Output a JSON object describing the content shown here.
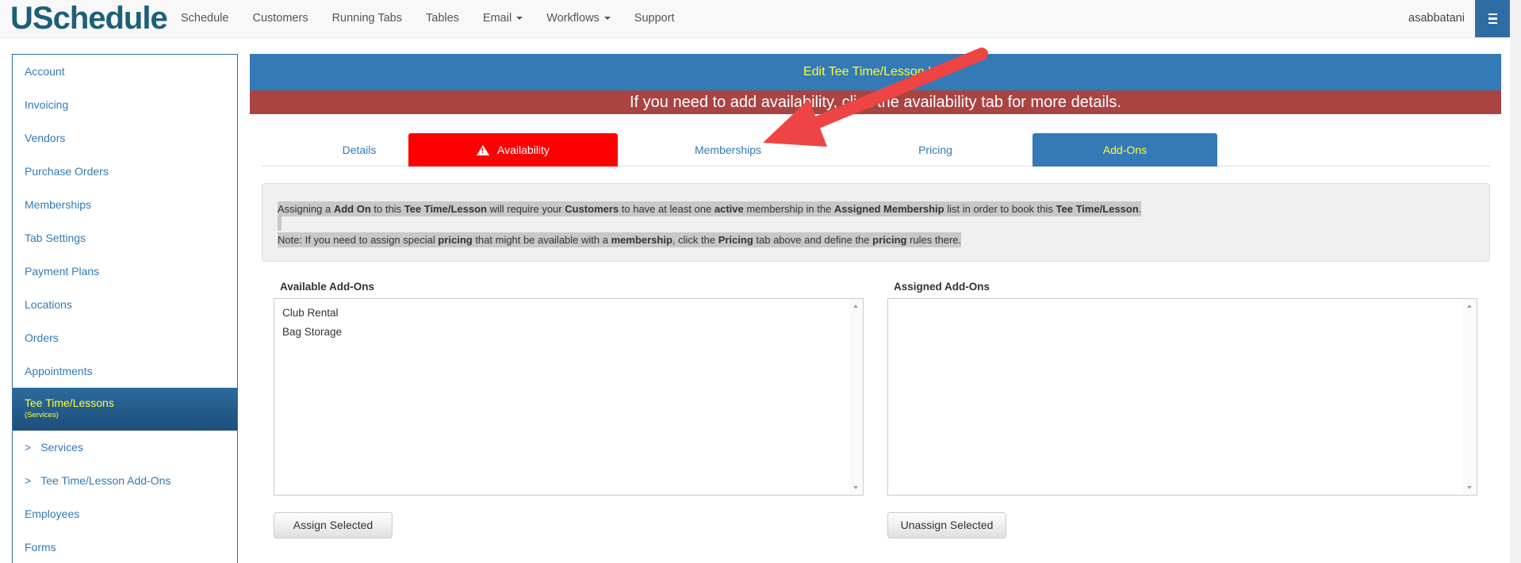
{
  "brand": "USchedule",
  "nav": {
    "items": [
      {
        "label": "Schedule",
        "dropdown": false
      },
      {
        "label": "Customers",
        "dropdown": false
      },
      {
        "label": "Running Tabs",
        "dropdown": false
      },
      {
        "label": "Tables",
        "dropdown": false
      },
      {
        "label": "Email",
        "dropdown": true
      },
      {
        "label": "Workflows",
        "dropdown": true
      },
      {
        "label": "Support",
        "dropdown": false
      }
    ],
    "username": "asabbatani"
  },
  "sidebar": {
    "items": [
      {
        "label": "Account"
      },
      {
        "label": "Invoicing"
      },
      {
        "label": "Vendors"
      },
      {
        "label": "Purchase Orders"
      },
      {
        "label": "Memberships"
      },
      {
        "label": "Tab Settings"
      },
      {
        "label": "Payment Plans"
      },
      {
        "label": "Locations"
      },
      {
        "label": "Orders"
      },
      {
        "label": "Appointments"
      },
      {
        "label": "Tee Time/Lessons",
        "sub": "(Services)",
        "active": true
      },
      {
        "label": "Services",
        "prefix": ">"
      },
      {
        "label": "Tee Time/Lesson Add-Ons",
        "prefix": ">"
      },
      {
        "label": "Employees"
      },
      {
        "label": "Forms"
      }
    ]
  },
  "header": {
    "title": "Edit Tee Time/Lesson List",
    "alert": "If you need to add availability, click the availability tab for more details."
  },
  "tabs": [
    {
      "label": "Details",
      "state": "normal"
    },
    {
      "label": "Availability",
      "state": "warning"
    },
    {
      "label": "Memberships",
      "state": "normal"
    },
    {
      "label": "Pricing",
      "state": "normal"
    },
    {
      "label": "Add-Ons",
      "state": "active"
    }
  ],
  "info": {
    "line1": [
      {
        "t": "Assigning a ",
        "b": false
      },
      {
        "t": "Add On",
        "b": true
      },
      {
        "t": " to this ",
        "b": false
      },
      {
        "t": "Tee Time/Lesson",
        "b": true
      },
      {
        "t": " will require your ",
        "b": false
      },
      {
        "t": "Customers",
        "b": true
      },
      {
        "t": " to have at least one ",
        "b": false
      },
      {
        "t": "active",
        "b": true
      },
      {
        "t": " membership in the ",
        "b": false
      },
      {
        "t": "Assigned Membership",
        "b": true
      },
      {
        "t": " list in order to book this ",
        "b": false
      },
      {
        "t": "Tee Time/Lesson",
        "b": true
      },
      {
        "t": ".",
        "b": false
      }
    ],
    "line2": [
      {
        "t": "Note: If you need to assign special ",
        "b": false
      },
      {
        "t": "pricing",
        "b": true
      },
      {
        "t": " that might be available with a ",
        "b": false
      },
      {
        "t": "membership",
        "b": true
      },
      {
        "t": ", click the ",
        "b": false
      },
      {
        "t": "Pricing",
        "b": true
      },
      {
        "t": " tab above and define the ",
        "b": false
      },
      {
        "t": "pricing",
        "b": true
      },
      {
        "t": " rules there.",
        "b": false
      }
    ]
  },
  "available": {
    "label": "Available Add-Ons",
    "options": [
      "Club Rental",
      "Bag Storage"
    ],
    "button": "Assign Selected"
  },
  "assigned": {
    "label": "Assigned Add-Ons",
    "options": [],
    "button": "Unassign Selected"
  },
  "colors": {
    "brand": "#1d5f79",
    "primary": "#337ab7",
    "alert": "#a94442",
    "warning_tab": "#ff0000",
    "highlight_text": "#ffff33",
    "annotation_arrow": "#ef4444"
  }
}
